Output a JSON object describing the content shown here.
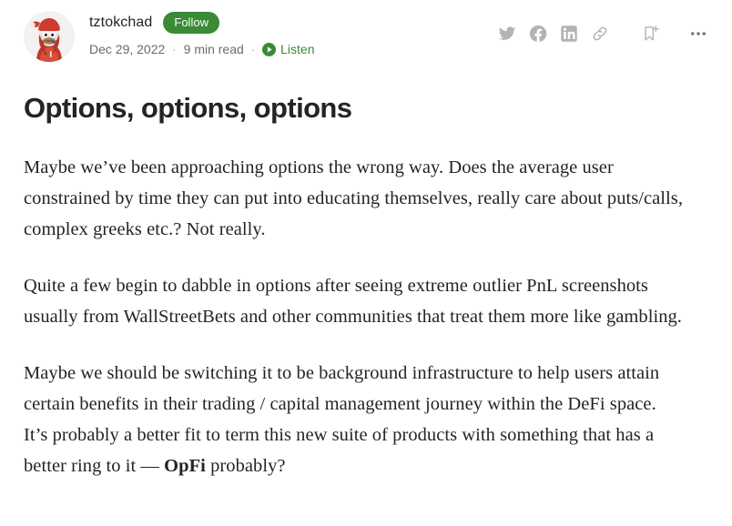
{
  "colors": {
    "accent_green": "#3a8a36",
    "text_primary": "#242424",
    "text_muted": "#6b6b6b",
    "icon_grey": "#b3b3b3",
    "background": "#ffffff"
  },
  "byline": {
    "author_name": "tztokchad",
    "follow_label": "Follow",
    "date": "Dec 29, 2022",
    "separator": "·",
    "read_time": "9 min read",
    "listen_label": "Listen",
    "avatar_alt": "tztokchad avatar"
  },
  "actions": [
    {
      "name": "share-twitter-icon",
      "label": "Share on Twitter"
    },
    {
      "name": "share-facebook-icon",
      "label": "Share on Facebook"
    },
    {
      "name": "share-linkedin-icon",
      "label": "Share on LinkedIn"
    },
    {
      "name": "copy-link-icon",
      "label": "Copy link"
    },
    {
      "name": "bookmark-add-icon",
      "label": "Save to list"
    },
    {
      "name": "more-options-icon",
      "label": "More options"
    }
  ],
  "article": {
    "title": "Options, options, options",
    "paragraphs": [
      "Maybe we’ve been approaching options the wrong way. Does the average user constrained by time they can put into educating themselves, really care about puts/calls, complex greeks etc.? Not really.",
      "Quite a few begin to dabble in options after seeing extreme outlier PnL screenshots usually from WallStreetBets and other communities that treat them more like gambling.",
      null
    ],
    "paragraph3": {
      "part1": "Maybe we should be switching it to be background infrastructure to help users attain certain benefits in their trading / capital management journey within the DeFi space. It’s probably a better fit to term this new suite of products with something that has a better ring to it — ",
      "bold": "OpFi",
      "part2": " probably?"
    }
  }
}
